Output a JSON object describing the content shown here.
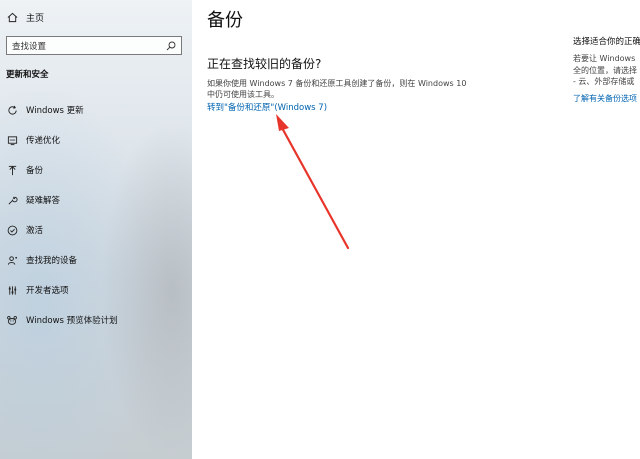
{
  "sidebar": {
    "home_label": "主页",
    "search_placeholder": "查找设置",
    "section_title": "更新和安全",
    "items": [
      {
        "label": "Windows 更新",
        "icon": "refresh-icon"
      },
      {
        "label": "传递优化",
        "icon": "delivery-optimization-icon"
      },
      {
        "label": "备份",
        "icon": "backup-arrow-icon"
      },
      {
        "label": "疑难解答",
        "icon": "wrench-icon"
      },
      {
        "label": "激活",
        "icon": "check-circle-icon"
      },
      {
        "label": "查找我的设备",
        "icon": "person-location-icon"
      },
      {
        "label": "开发者选项",
        "icon": "developer-icon"
      },
      {
        "label": "Windows 预览体验计划",
        "icon": "insider-icon"
      }
    ]
  },
  "main": {
    "title": "备份",
    "subheading": "正在查找较旧的备份?",
    "description_line1": "如果你使用 Windows 7 备份和还原工具创建了备份，则在 Windows 10",
    "description_line2": "中仍可使用该工具。",
    "link": "转到\"备份和还原\"(Windows 7)"
  },
  "right_panel": {
    "title": "选择适合你的正确",
    "line1": "若要让 Windows",
    "line2": "全的位置，请选择",
    "line3": "- 云、外部存储或",
    "link": "了解有关备份选项"
  },
  "colors": {
    "accent_link": "#0063b1",
    "arrow": "#e8352b"
  }
}
